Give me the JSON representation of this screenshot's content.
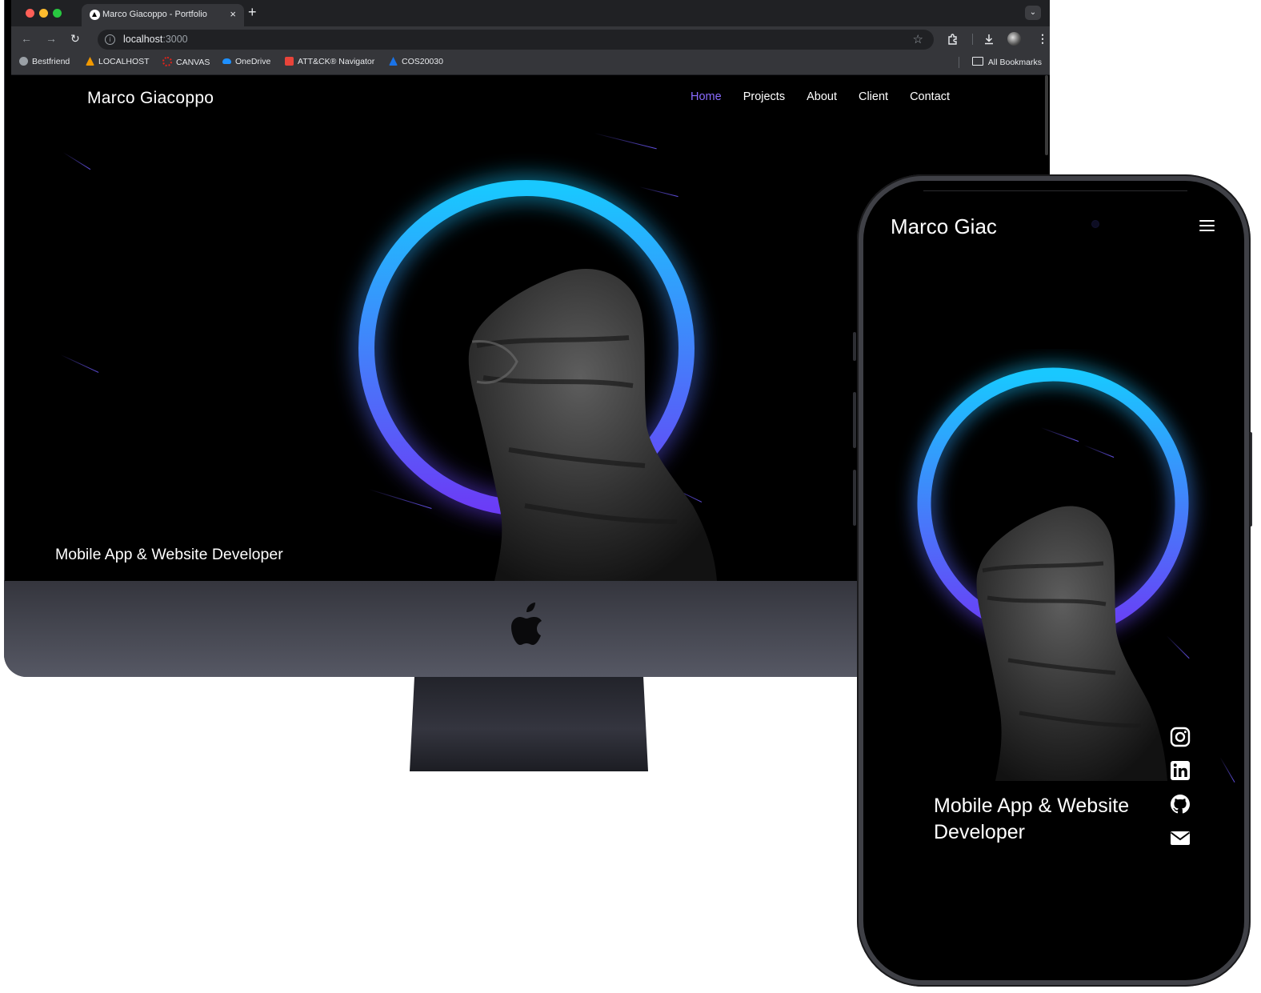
{
  "browser": {
    "tab_title": "Marco Giacoppo - Portfolio",
    "tab_close": "×",
    "new_tab": "+",
    "url_host": "localhost",
    "url_port": ":3000",
    "bookmarks": [
      {
        "label": "Bestfriend",
        "color": "#8ab4f8"
      },
      {
        "label": "LOCALHOST",
        "color": "#f29900"
      },
      {
        "label": "CANVAS",
        "color": "#e2231a"
      },
      {
        "label": "OneDrive",
        "color": "#1e90ff"
      },
      {
        "label": "ATT&CK® Navigator",
        "color": "#e8443a"
      },
      {
        "label": "COS20030",
        "color": "#1a73e8"
      }
    ],
    "all_bookmarks": "All Bookmarks"
  },
  "site": {
    "brand": "Marco Giacoppo",
    "nav": [
      "Home",
      "Projects",
      "About",
      "Client",
      "Contact"
    ],
    "active_nav": "Home",
    "subtitle": "Mobile App & Website Developer",
    "accent_color": "#8a6cff",
    "ring_colors": [
      "#19c8ff",
      "#6b3cf6"
    ]
  },
  "mobile": {
    "brand": "Marco Giac",
    "subtitle": "Mobile App & Website Developer",
    "social_icons": [
      "instagram-icon",
      "linkedin-icon",
      "github-icon",
      "email-icon"
    ]
  }
}
